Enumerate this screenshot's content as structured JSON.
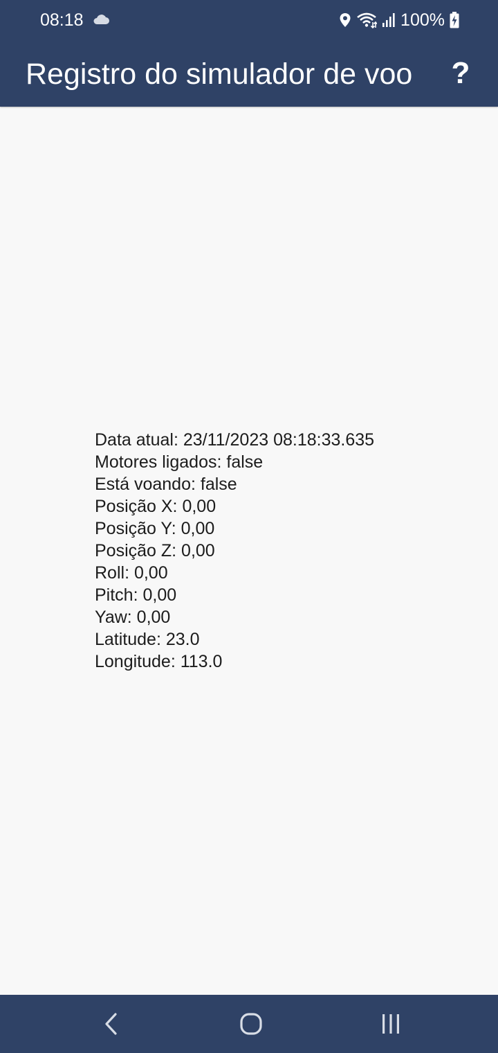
{
  "status_bar": {
    "time": "08:18",
    "battery": "100%",
    "icons": [
      "cloud-icon",
      "location-icon",
      "wifi-icon",
      "signal-icon",
      "battery-charging-icon"
    ]
  },
  "app_bar": {
    "title": "Registro do simulador de voo",
    "help_label": "?"
  },
  "log": {
    "lines": [
      "Data atual: 23/11/2023 08:18:33.635",
      "Motores ligados: false",
      "Está voando: false",
      "Posição X: 0,00",
      "Posição Y: 0,00",
      "Posição Z: 0,00",
      "Roll: 0,00",
      "Pitch: 0,00",
      "Yaw: 0,00",
      "Latitude: 23.0",
      "Longitude: 113.0"
    ]
  },
  "nav_bar": {
    "icons": [
      "back-icon",
      "home-icon",
      "recent-apps-icon"
    ]
  },
  "colors": {
    "header": "#2f4266",
    "background": "#f8f8f8",
    "text": "#1c1c1c"
  }
}
